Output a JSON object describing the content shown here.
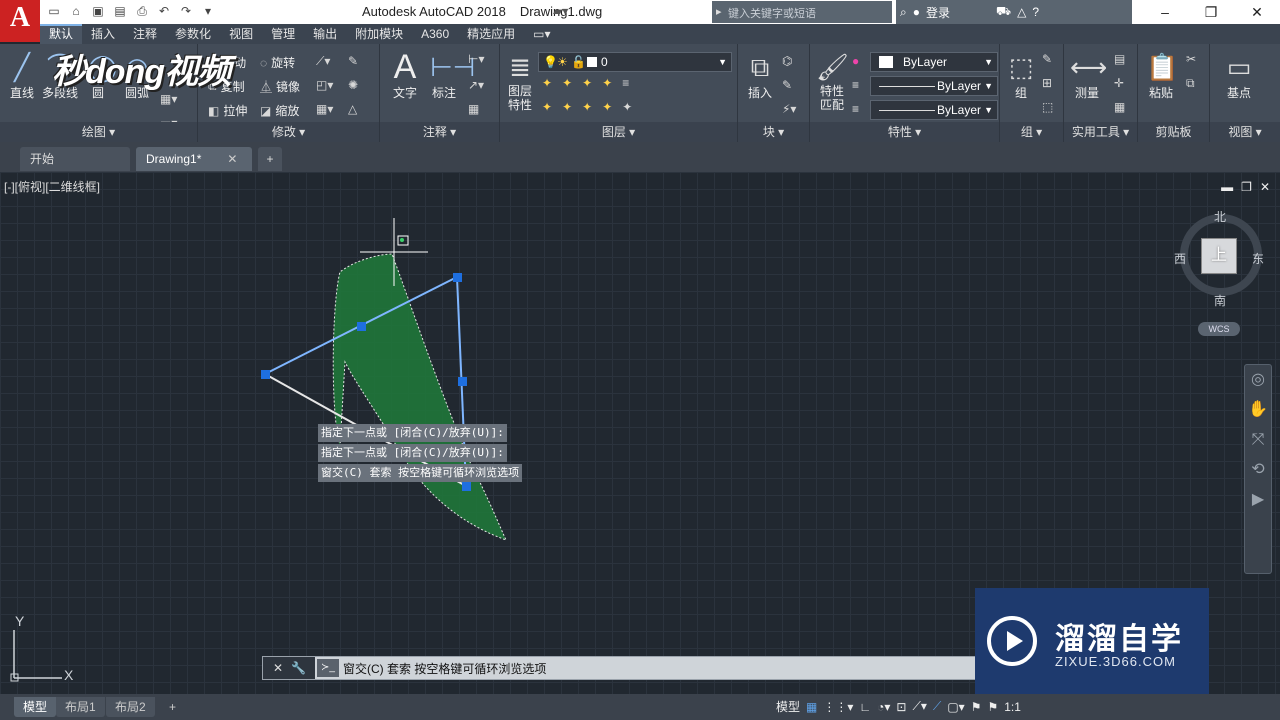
{
  "titlebar": {
    "app_logo": "A",
    "app_name": "Autodesk AutoCAD 2018",
    "doc_name": "Drawing1.dwg",
    "search_placeholder": "键入关键字或短语",
    "login": "登录"
  },
  "menu_tabs": [
    "默认",
    "插入",
    "注释",
    "参数化",
    "视图",
    "管理",
    "输出",
    "附加模块",
    "A360",
    "精选应用"
  ],
  "ribbon": {
    "draw": {
      "line": "直线",
      "polyline": "多段线",
      "circle": "圆",
      "arc": "圆弧",
      "footer": "绘图 ▾"
    },
    "modify": {
      "move": "移动",
      "rotate": "旋转",
      "copy": "复制",
      "mirror": "镜像",
      "stretch": "拉伸",
      "scale": "缩放",
      "footer": "修改 ▾"
    },
    "annotation": {
      "text": "文字",
      "dimension": "标注",
      "footer": "注释 ▾"
    },
    "layers": {
      "layer_props_1": "图层",
      "layer_props_2": "特性",
      "layer_name": "0",
      "footer": "图层 ▾"
    },
    "block": {
      "insert": "插入",
      "footer": "块 ▾"
    },
    "properties": {
      "match_1": "特性",
      "match_2": "匹配",
      "color": "ByLayer",
      "linetype": "ByLayer",
      "lineweight": "ByLayer",
      "footer": "特性 ▾"
    },
    "groups": {
      "group": "组",
      "footer": "组 ▾"
    },
    "utilities": {
      "measure": "测量",
      "footer": "实用工具 ▾"
    },
    "clipboard": {
      "paste": "粘贴",
      "footer": "剪贴板"
    },
    "view": {
      "base": "基点",
      "footer": "视图 ▾"
    }
  },
  "watermark_left": "秒dong视频",
  "doc_tabs": {
    "start": "开始",
    "drawing": "Drawing1*",
    "close": "✕",
    "add": "+"
  },
  "viewport": {
    "label": "[-][俯视][二维线框]",
    "viewcube": {
      "top": "上",
      "north": "北",
      "south": "南",
      "east": "东",
      "west": "西",
      "wcs": "WCS"
    },
    "ucs_x": "X",
    "ucs_y": "Y"
  },
  "command": {
    "history": [
      "指定下一点或 [闭合(C)/放弃(U)]:",
      "指定下一点或 [闭合(C)/放弃(U)]:",
      "窗交(C) 套索  按空格键可循环浏览选项"
    ],
    "current": "窗交(C)  套索   按空格键可循环浏览选项"
  },
  "layout_tabs": [
    "模型",
    "布局1",
    "布局2"
  ],
  "status": {
    "model": "模型",
    "scale": "1:1"
  },
  "brand_watermark": {
    "name": "溜溜自学",
    "url": "ZIXUE.3D66.COM"
  },
  "colors": {
    "accent": "#7fb2e6",
    "grip": "#1e6fe0",
    "lasso_fill": "#1f7a3a",
    "selected_line": "#7fb6ff"
  }
}
